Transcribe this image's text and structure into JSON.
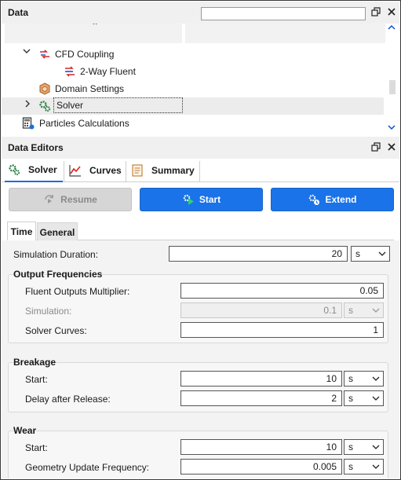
{
  "data_panel": {
    "title": "Data",
    "tree": [
      {
        "label": "CFD Coupling",
        "icon": "cfd-coupling-icon",
        "expander": "⌄"
      },
      {
        "label": "2-Way Fluent",
        "icon": "fluent-icon",
        "expander": ""
      },
      {
        "label": "Domain Settings",
        "icon": "domain-settings-icon",
        "expander": ""
      },
      {
        "label": "Solver",
        "icon": "solver-gears-icon",
        "expander": "›"
      },
      {
        "label": "Particles Calculations",
        "icon": "calculator-icon",
        "expander": ""
      }
    ]
  },
  "editors_panel": {
    "title": "Data Editors",
    "tabs": [
      {
        "label": "Solver",
        "icon": "solver-gears-icon"
      },
      {
        "label": "Curves",
        "icon": "curves-chart-icon"
      },
      {
        "label": "Summary",
        "icon": "summary-doc-icon"
      }
    ],
    "actions": {
      "resume": "Resume",
      "start": "Start",
      "extend": "Extend"
    },
    "subtabs": [
      "Time",
      "General"
    ]
  },
  "form": {
    "simulation_duration": {
      "label": "Simulation Duration:",
      "value": "20",
      "unit": "s"
    },
    "output_frequencies": {
      "title": "Output Frequencies",
      "fluent_outputs_multiplier": {
        "label": "Fluent Outputs Multiplier:",
        "value": "0.05"
      },
      "simulation": {
        "label": "Simulation:",
        "value": "0.1",
        "unit": "s"
      },
      "solver_curves": {
        "label": "Solver Curves:",
        "value": "1"
      }
    },
    "breakage": {
      "title": "Breakage",
      "start": {
        "label": "Start:",
        "value": "10",
        "unit": "s"
      },
      "delay_after_release": {
        "label": "Delay after Release:",
        "value": "2",
        "unit": "s"
      }
    },
    "wear": {
      "title": "Wear",
      "start": {
        "label": "Start:",
        "value": "10",
        "unit": "s"
      },
      "geometry_update_frequency": {
        "label": "Geometry Update Frequency:",
        "value": "0.005",
        "unit": "s"
      }
    }
  },
  "colors": {
    "accent": "#1a73e8",
    "disabled": "#d6d6d6"
  }
}
